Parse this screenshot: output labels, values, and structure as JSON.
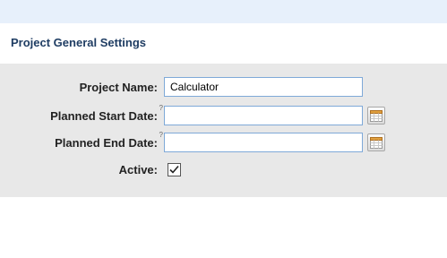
{
  "section": {
    "title": "Project General Settings"
  },
  "form": {
    "project_name": {
      "label": "Project Name:",
      "value": "Calculator"
    },
    "planned_start_date": {
      "label": "Planned Start Date:",
      "help_mark": "?",
      "value": ""
    },
    "planned_end_date": {
      "label": "Planned End Date:",
      "help_mark": "?",
      "value": ""
    },
    "active": {
      "label": "Active:",
      "checked": true
    }
  },
  "icons": {
    "calendar": "calendar-icon",
    "checkmark": "checkmark-icon"
  },
  "colors": {
    "top_bar": "#e7f0fb",
    "title": "#1f3d63",
    "panel": "#e8e8e8",
    "input_border": "#7fa9d8"
  }
}
